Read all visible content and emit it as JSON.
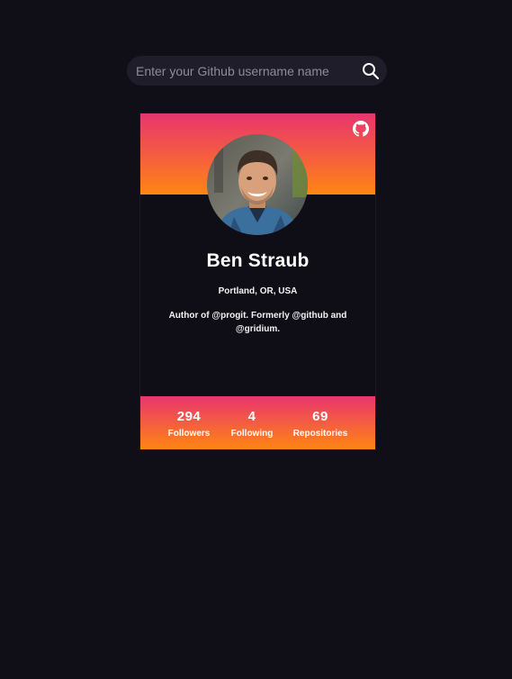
{
  "search": {
    "placeholder": "Enter your Github username name",
    "value": ""
  },
  "profile": {
    "name": "Ben Straub",
    "location": "Portland, OR, USA",
    "bio": "Author of @progit. Formerly @github and @gridium."
  },
  "stats": [
    {
      "value": "294",
      "label": "Followers"
    },
    {
      "value": "4",
      "label": "Following"
    },
    {
      "value": "69",
      "label": "Repositories"
    }
  ],
  "icons": {
    "search": "search-icon",
    "github": "github-icon"
  },
  "colors": {
    "background": "#100f18",
    "search_bg": "#1e1d29",
    "card_bg": "#0f0e16",
    "gradient_top": "#e8356e",
    "gradient_bottom": "#fe8612",
    "text": "#ffffff"
  }
}
